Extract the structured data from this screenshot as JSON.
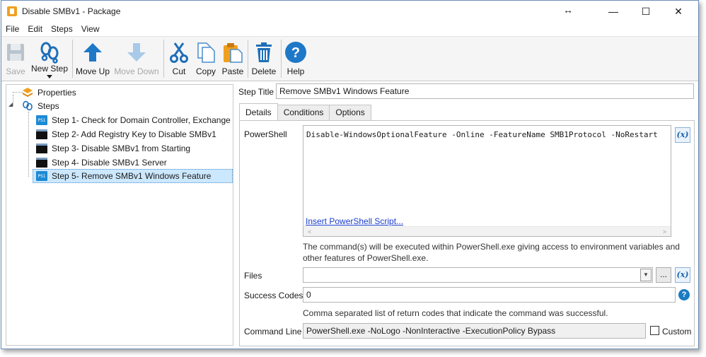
{
  "window": {
    "title": "Disable SMBv1 - Package",
    "resize_glyph": "↔",
    "minimize": "—",
    "maximize": "☐",
    "close": "✕"
  },
  "menu": [
    "File",
    "Edit",
    "Steps",
    "View"
  ],
  "toolbar": {
    "save": "Save",
    "new_step": "New Step",
    "move_up": "Move Up",
    "move_down": "Move Down",
    "cut": "Cut",
    "copy": "Copy",
    "paste": "Paste",
    "delete": "Delete",
    "help": "Help"
  },
  "tree": {
    "properties": "Properties",
    "steps": "Steps",
    "items": [
      {
        "label": "Step 1- Check for Domain Controller, Exchange",
        "icon": "powershell-icon"
      },
      {
        "label": "Step 2- Add Registry Key to Disable SMBv1",
        "icon": "cmd-icon"
      },
      {
        "label": "Step 3- Disable SMBv1 from Starting",
        "icon": "cmd-icon"
      },
      {
        "label": "Step 4- Disable SMBv1 Server",
        "icon": "cmd-icon"
      },
      {
        "label": "Step 5- Remove SMBv1 Windows Feature",
        "icon": "powershell-icon"
      }
    ]
  },
  "detail": {
    "step_title_label": "Step Title",
    "step_title_value": "Remove SMBv1 Windows Feature",
    "tabs": [
      "Details",
      "Conditions",
      "Options"
    ],
    "powershell_label": "PowerShell",
    "powershell_code": "Disable-WindowsOptionalFeature -Online -FeatureName SMB1Protocol -NoRestart",
    "insert_link": "Insert PowerShell Script...",
    "powershell_hint_1": "The command(s) will be executed within PowerShell.exe giving access to environment variables and",
    "powershell_hint_2": "other features of PowerShell.exe.",
    "files_label": "Files",
    "files_value": "",
    "browse": "...",
    "variable_button": "(x)",
    "success_codes_label": "Success Codes",
    "success_codes_value": "0",
    "success_hint": "Comma separated list of return codes that indicate the command was successful.",
    "command_line_label": "Command Line",
    "command_line_value": "PowerShell.exe -NoLogo -NonInteractive -ExecutionPolicy Bypass",
    "custom_label": "Custom",
    "help_glyph": "?"
  },
  "colors": {
    "accent_blue": "#1a7cc2",
    "selection": "#cce8ff",
    "link": "#1a3ccc"
  }
}
